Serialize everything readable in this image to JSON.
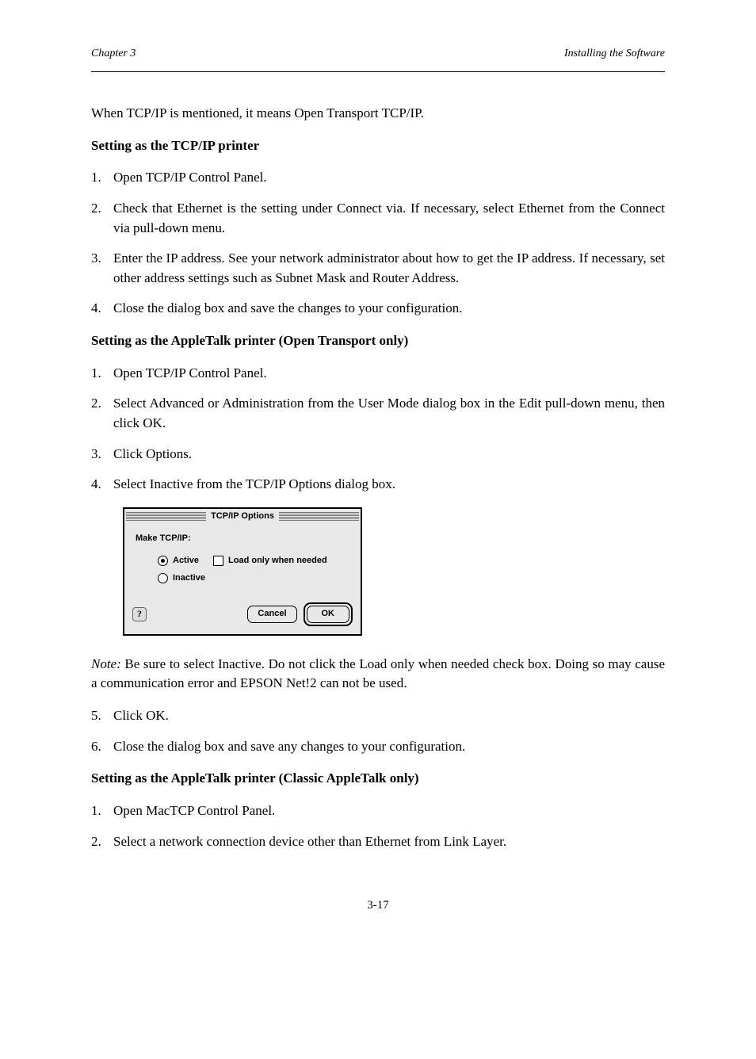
{
  "header": {
    "chapter": "Chapter 3",
    "title": "Installing the Software"
  },
  "intro": "When TCP/IP is mentioned, it means Open Transport TCP/IP.",
  "sec1": {
    "heading": "Setting as the TCP/IP printer",
    "steps": [
      "Open TCP/IP Control Panel.",
      "Check that Ethernet is the setting under Connect via. If necessary, select Ethernet from the Connect via pull-down menu.",
      "Enter the IP address. See your network administrator about how to get the IP address. If necessary, set other address settings such as Subnet Mask and Router Address.",
      "Close the dialog box and save the changes to your configuration."
    ]
  },
  "sec2": {
    "heading": "Setting as the AppleTalk printer (Open Transport only)",
    "steps_a": [
      "Open TCP/IP Control Panel.",
      "Select Advanced or Administration from the User Mode dialog box in the Edit pull-down menu, then click OK.",
      "Click Options.",
      "Select Inactive from the TCP/IP Options dialog box."
    ]
  },
  "dialog": {
    "title": "TCP/IP Options",
    "label": "Make TCP/IP:",
    "opt_active": "Active",
    "opt_loadonly": "Load only when needed",
    "opt_inactive": "Inactive",
    "help_glyph": "?",
    "btn_cancel": "Cancel",
    "btn_ok": "OK"
  },
  "note": {
    "label": "Note:",
    "text": " Be sure to select Inactive. Do not click the Load only when needed check box. Doing so may cause a communication error and EPSON Net!2 can not be used."
  },
  "sec2_cont": [
    "Click OK.",
    "Close the dialog box and save any changes to your configuration."
  ],
  "sec3": {
    "heading": "Setting as the AppleTalk printer (Classic AppleTalk only)",
    "steps": [
      "Open MacTCP Control Panel.",
      "Select a network connection device other than Ethernet from Link Layer."
    ]
  },
  "page_number": "3-17"
}
